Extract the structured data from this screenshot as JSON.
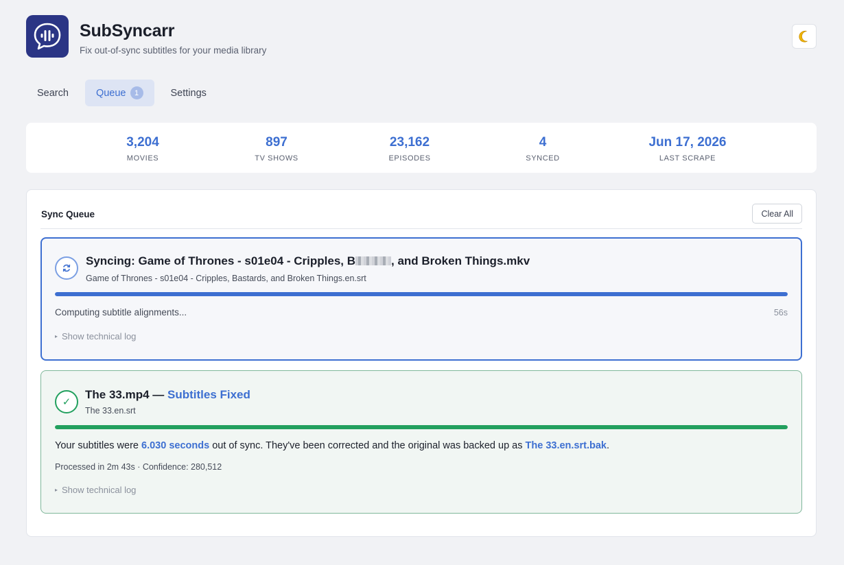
{
  "app": {
    "title": "SubSyncarr",
    "subtitle": "Fix out-of-sync subtitles for your media library",
    "theme_icon": "moon-icon"
  },
  "tabs": [
    {
      "label": "Search",
      "active": false
    },
    {
      "label": "Queue",
      "active": true,
      "badge": "1"
    },
    {
      "label": "Settings",
      "active": false
    }
  ],
  "stats": [
    {
      "value": "3,204",
      "label": "MOVIES"
    },
    {
      "value": "897",
      "label": "TV SHOWS"
    },
    {
      "value": "23,162",
      "label": "EPISODES"
    },
    {
      "value": "4",
      "label": "SYNCED"
    },
    {
      "value": "Jun 17, 2026",
      "label": "LAST SCRAPE"
    }
  ],
  "queue": {
    "title": "Sync Queue",
    "clear_label": "Clear All",
    "jobs": [
      {
        "state": "syncing",
        "icon": "sync-icon",
        "title_prefix": "Syncing: Game of Thrones - s01e04 - Cripples, B",
        "title_suffix": ", and Broken Things.mkv",
        "subtitle_file": "Game of Thrones - s01e04 - Cripples, Bastards, and Broken Things.en.srt",
        "progress": 1.0,
        "status": "Computing subtitle alignments...",
        "elapsed": "56s",
        "log_label": "Show technical log"
      },
      {
        "state": "done",
        "icon": "check-icon",
        "title_name": "The 33.mp4 — ",
        "title_status": "Subtitles Fixed",
        "subtitle_file": "The 33.en.srt",
        "progress": 1.0,
        "result_pre": "Your subtitles were ",
        "result_offset": "6.030 seconds",
        "result_mid": " out of sync. They've been corrected and the original was backed up as ",
        "result_backup": "The 33.en.srt.bak",
        "result_post": ".",
        "meta": "Processed in 2m 43s · Confidence: 280,512",
        "log_label": "Show technical log"
      }
    ]
  },
  "colors": {
    "accent": "#3d6fd1",
    "success": "#22a05e",
    "logo_bg": "#2b3585"
  }
}
